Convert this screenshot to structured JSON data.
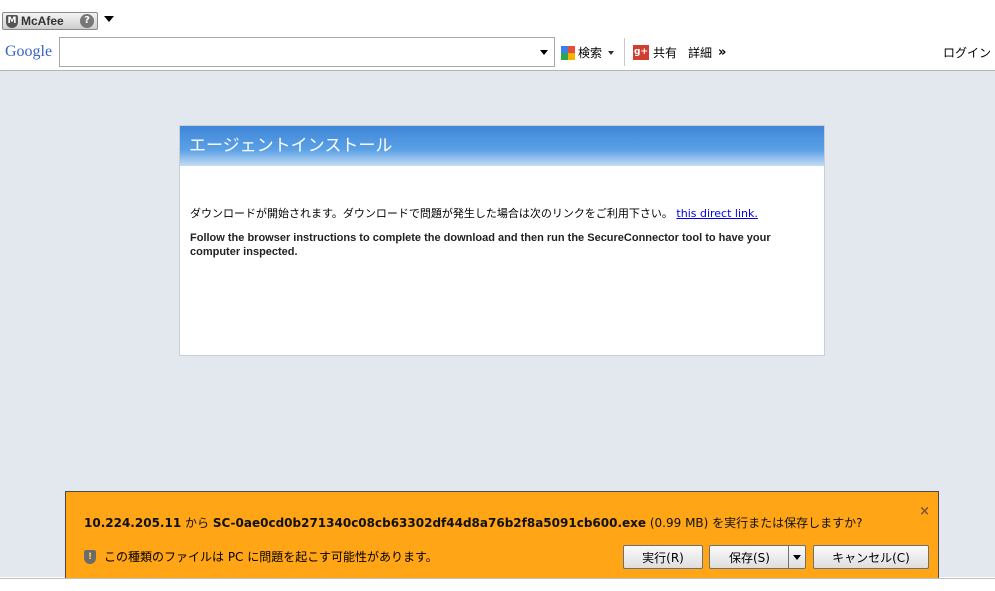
{
  "mcafee": {
    "label": "McAfee",
    "help": "?"
  },
  "google": {
    "logo": "Google",
    "search_value": "",
    "search_label": "検索",
    "share_label": "共有",
    "details_label": "詳細",
    "details_chevron": "»",
    "login_label": "ログイン"
  },
  "dialog": {
    "title": "エージェントインストール",
    "message_jp": "ダウンロードが開始されます。ダウンロードで問題が発生した場合は次のリンクをご利用下さい。",
    "link_text": "this direct link.",
    "message_en": "Follow the browser instructions to complete the download and then run the SecureConnector tool to have your computer inspected."
  },
  "download_bar": {
    "host": "10.224.205.11",
    "from_text": " から ",
    "filename": "SC-0ae0cd0b271340c08cb63302df44d8a76b2f8a5091cb600.exe",
    "size": " (0.99 MB) ",
    "question_tail": "を実行または保存しますか?",
    "warning": "この種類のファイルは PC に問題を起こす可能性があります。",
    "run_label": "実行(R)",
    "save_label": "保存(S)",
    "cancel_label": "キャンセル(C)",
    "close_glyph": "×"
  },
  "icons": {
    "mcafee_shield": "mcafee-shield-icon",
    "help": "help-icon",
    "google_search": "google-search-icon",
    "gplus": "google-plus-icon",
    "security_shield": "shield-warning-icon",
    "close": "close-icon"
  },
  "colors": {
    "page_bg": "#e3e8ee",
    "dialog_header": "#4b94df",
    "download_bar": "#ffa516",
    "link": "#0000ee"
  }
}
